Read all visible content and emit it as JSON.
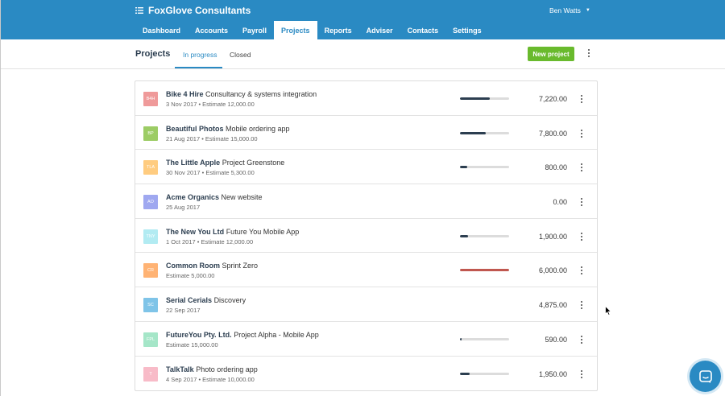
{
  "app": {
    "title": "FoxGlove Consultants",
    "user": "Ben Watts"
  },
  "nav": [
    {
      "label": "Dashboard",
      "active": false
    },
    {
      "label": "Accounts",
      "active": false
    },
    {
      "label": "Payroll",
      "active": false
    },
    {
      "label": "Projects",
      "active": true
    },
    {
      "label": "Reports",
      "active": false
    },
    {
      "label": "Adviser",
      "active": false
    },
    {
      "label": "Contacts",
      "active": false
    },
    {
      "label": "Settings",
      "active": false
    }
  ],
  "subheader": {
    "title": "Projects",
    "tabs": [
      {
        "label": "In progress",
        "active": true
      },
      {
        "label": "Closed",
        "active": false
      }
    ],
    "new_button": "New project"
  },
  "colors": {
    "brand": "#2a8ac3",
    "new_button": "#69ba2d",
    "progress_fill": "#2c3e50",
    "progress_over": "#c0574f"
  },
  "projects": [
    {
      "initials": "B4H",
      "color": "#ef9a9a",
      "client": "Bike 4 Hire",
      "name": "Consultancy & systems integration",
      "meta": "3 Nov 2017 • Estimate 12,000.00",
      "progress": 0.6,
      "over": false,
      "show_progress": true,
      "amount": "7,220.00"
    },
    {
      "initials": "BP",
      "color": "#9ccc65",
      "client": "Beautiful Photos",
      "name": "Mobile ordering app",
      "meta": "21 Aug 2017 • Estimate 15,000.00",
      "progress": 0.52,
      "over": false,
      "show_progress": true,
      "amount": "7,800.00"
    },
    {
      "initials": "TLA",
      "color": "#ffcc80",
      "client": "The Little Apple",
      "name": "Project Greenstone",
      "meta": "30 Nov 2017 • Estimate 5,300.00",
      "progress": 0.15,
      "over": false,
      "show_progress": true,
      "amount": "800.00"
    },
    {
      "initials": "AO",
      "color": "#9fa8f0",
      "client": "Acme Organics",
      "name": "New website",
      "meta": "25 Aug 2017",
      "progress": 0,
      "over": false,
      "show_progress": false,
      "amount": "0.00"
    },
    {
      "initials": "TNY",
      "color": "#b2ebf2",
      "client": "The New You Ltd",
      "name": "Future You Mobile App",
      "meta": "1 Oct 2017 • Estimate 12,000.00",
      "progress": 0.16,
      "over": false,
      "show_progress": true,
      "amount": "1,900.00"
    },
    {
      "initials": "CR",
      "color": "#ffb374",
      "client": "Common Room",
      "name": "Sprint Zero",
      "meta": "Estimate 5,000.00",
      "progress": 1.0,
      "over": true,
      "show_progress": true,
      "amount": "6,000.00"
    },
    {
      "initials": "SC",
      "color": "#7fc4e8",
      "client": "Serial Cerials",
      "name": "Discovery",
      "meta": "22 Sep 2017",
      "progress": 0,
      "over": false,
      "show_progress": false,
      "amount": "4,875.00"
    },
    {
      "initials": "FPL",
      "color": "#a5e6c8",
      "client": "FutureYou Pty. Ltd.",
      "name": "Project Alpha - Mobile App",
      "meta": "Estimate 15,000.00",
      "progress": 0.04,
      "over": false,
      "show_progress": true,
      "amount": "590.00"
    },
    {
      "initials": "T",
      "color": "#f8bbc8",
      "client": "TalkTalk",
      "name": "Photo ordering app",
      "meta": "4 Sep 2017 • Estimate 10,000.00",
      "progress": 0.2,
      "over": false,
      "show_progress": true,
      "amount": "1,950.00"
    }
  ],
  "icons": {
    "brand": "menu-list-icon",
    "user_caret": "caret-down-icon",
    "row_more": "vertical-dots-icon",
    "chat": "chat-bubble-icon"
  }
}
